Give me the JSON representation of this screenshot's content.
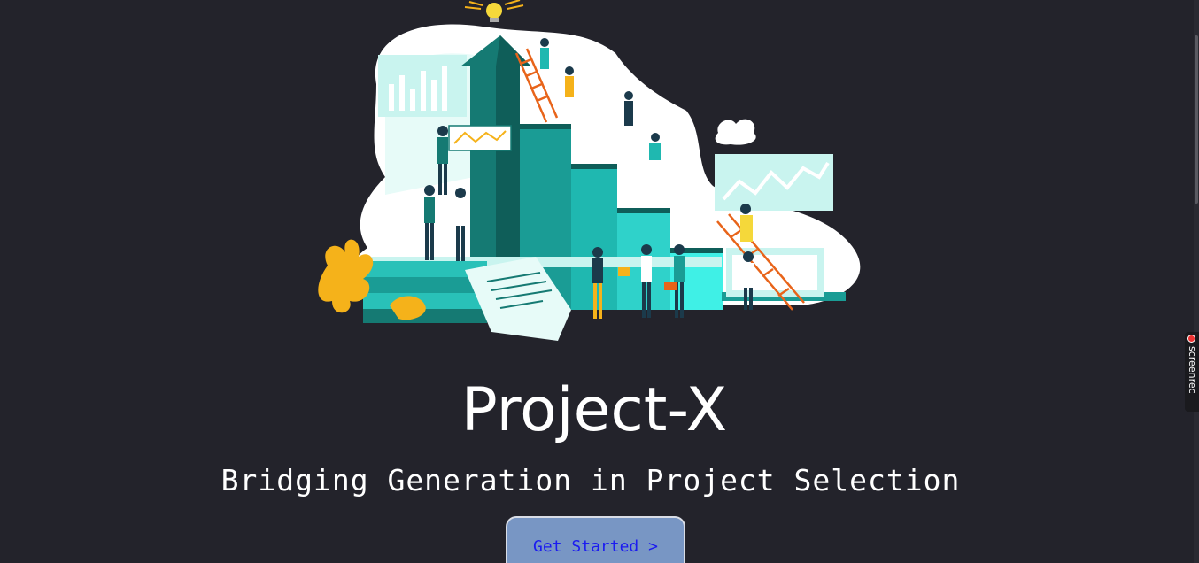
{
  "hero": {
    "title": "Project-X",
    "subtitle": "Bridging Generation in Project Selection",
    "cta_label": "Get Started >"
  },
  "illustration": {
    "description_icon": "teamwork-growth-illustration"
  },
  "recorder": {
    "label": "screenrec"
  },
  "colors": {
    "background": "#23232b",
    "cta_background": "#7896c4",
    "cta_text": "#1b1bf0",
    "teal": "#1fb8b0",
    "mint": "#c9f4ef",
    "accent_yellow": "#f5b21a"
  }
}
